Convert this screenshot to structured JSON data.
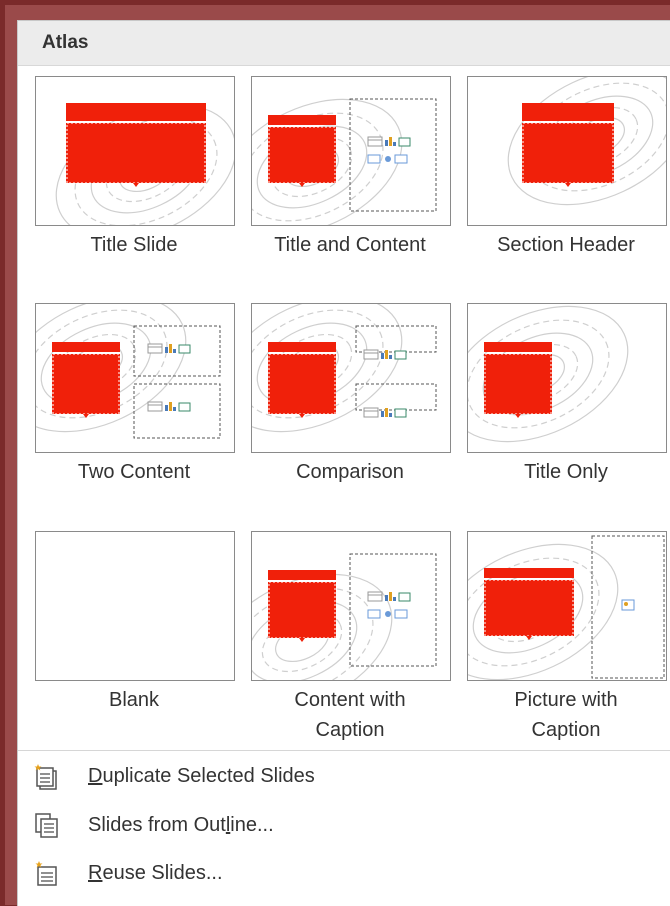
{
  "gallery": {
    "title": "Atlas",
    "layouts": [
      {
        "label": "Title Slide",
        "kind": "title"
      },
      {
        "label": "Title and Content",
        "kind": "title-content"
      },
      {
        "label": "Section Header",
        "kind": "section"
      },
      {
        "label": "Two Content",
        "kind": "two-content"
      },
      {
        "label": "Comparison",
        "kind": "comparison"
      },
      {
        "label": "Title Only",
        "kind": "title-only"
      },
      {
        "label": "Blank",
        "kind": "blank"
      },
      {
        "label": "Content with\nCaption",
        "kind": "content-caption"
      },
      {
        "label": "Picture with\nCaption",
        "kind": "picture-caption"
      }
    ]
  },
  "menu": {
    "duplicate": {
      "prefix": "",
      "accel": "D",
      "rest": "uplicate Selected Slides",
      "icon": "duplicate-slides-icon"
    },
    "outline": {
      "prefix": "Slides from Out",
      "accel": "l",
      "rest": "ine...",
      "icon": "slides-from-outline-icon"
    },
    "reuse": {
      "prefix": "",
      "accel": "R",
      "rest": "euse Slides...",
      "icon": "reuse-slides-icon"
    }
  },
  "colors": {
    "accent": "#f0200a",
    "header_bg": "#ececec",
    "frame": "#7a2a2a"
  }
}
